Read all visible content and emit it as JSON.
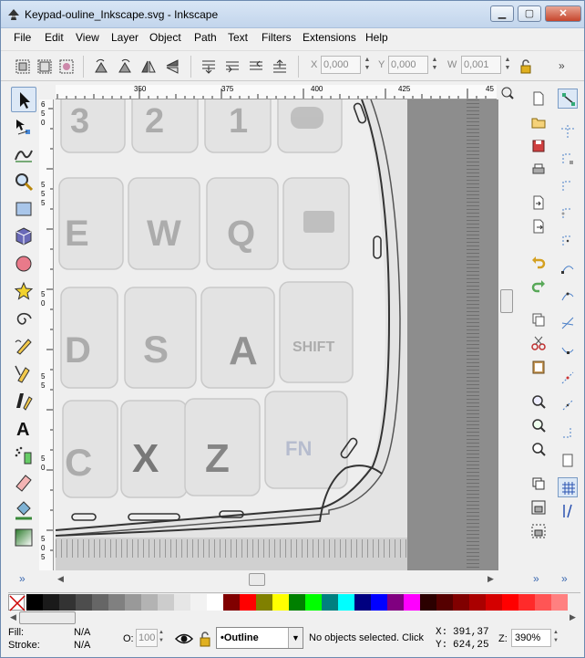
{
  "window": {
    "title": "Keypad-ouline_Inkscape.svg - Inkscape",
    "minimize_icon": "minimize-icon",
    "maximize_icon": "maximize-icon",
    "close_icon": "close-icon"
  },
  "menu": {
    "items": [
      "File",
      "Edit",
      "View",
      "Layer",
      "Object",
      "Path",
      "Text",
      "Filters",
      "Extensions",
      "Help"
    ]
  },
  "toolbar": {
    "x_label": "X",
    "x_value": "0,000",
    "y_label": "Y",
    "y_value": "0,000",
    "w_label": "W",
    "w_value": "0,001",
    "more": "»"
  },
  "ruler": {
    "top": [
      "350",
      "375",
      "400",
      "425",
      "45"
    ],
    "left": [
      "6",
      "5",
      "0",
      "5",
      "5",
      "5",
      "5",
      "0",
      "5",
      "5",
      "5",
      "0",
      "5",
      "0",
      "5",
      "5",
      "0"
    ]
  },
  "keypad": {
    "keys": [
      "3",
      "2",
      "1",
      "E",
      "W",
      "Q",
      "D",
      "S",
      "A",
      "SHIFT",
      "C",
      "X",
      "Z",
      "FN"
    ]
  },
  "toolbox": {
    "more": "»"
  },
  "commands": {
    "more": "»"
  },
  "snap": {
    "more": "»"
  },
  "palette": {
    "colors": [
      "#000000",
      "#1a1a1a",
      "#333333",
      "#4d4d4d",
      "#666666",
      "#808080",
      "#999999",
      "#b3b3b3",
      "#cccccc",
      "#e6e6e6",
      "#f2f2f2",
      "#ffffff",
      "#800000",
      "#ff0000",
      "#808000",
      "#ffff00",
      "#008000",
      "#00ff00",
      "#008080",
      "#00ffff",
      "#000080",
      "#0000ff",
      "#800080",
      "#ff00ff",
      "#2b0000",
      "#550000",
      "#800000",
      "#aa0000",
      "#d40000",
      "#ff0000",
      "#ff2a2a",
      "#ff5555",
      "#ff8080"
    ]
  },
  "status": {
    "fill_label": "Fill:",
    "fill_value": "N/A",
    "stroke_label": "Stroke:",
    "stroke_value": "N/A",
    "opacity_label": "O:",
    "opacity_value": "100",
    "layer": "•Outline",
    "message": "No objects selected. Click",
    "x_label": "X:",
    "x_value": "391,37",
    "y_label": "Y:",
    "y_value": "624,25",
    "zoom_label": "Z:",
    "zoom_value": "390%"
  }
}
